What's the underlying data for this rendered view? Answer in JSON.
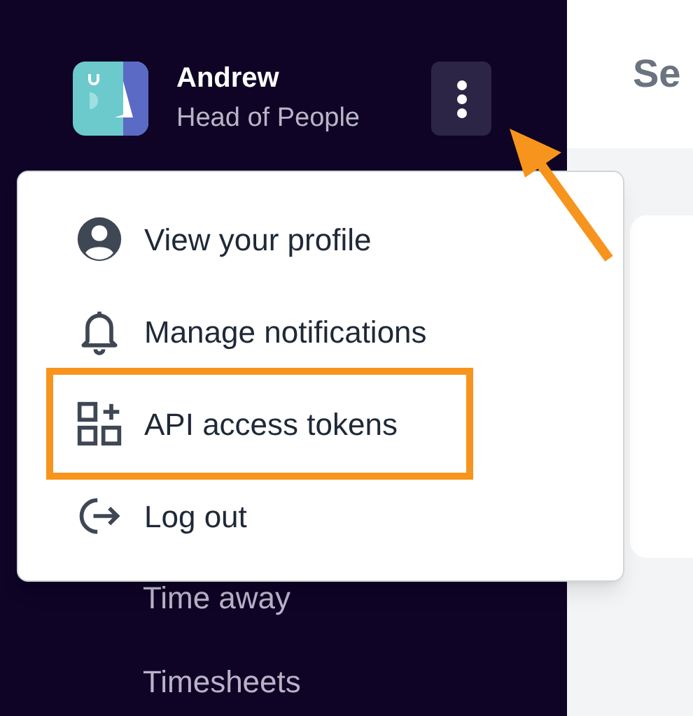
{
  "user": {
    "name": "Andrew",
    "role": "Head of People"
  },
  "page": {
    "title": "Se"
  },
  "menu": {
    "items": [
      {
        "label": "View your profile",
        "kind": "profile",
        "highlighted": false
      },
      {
        "label": "Manage notifications",
        "kind": "notifications",
        "highlighted": false
      },
      {
        "label": "API access tokens",
        "kind": "tokens",
        "highlighted": true
      },
      {
        "label": "Log out",
        "kind": "logout",
        "highlighted": false
      }
    ]
  },
  "sidebar": {
    "items": [
      {
        "label": "Time away"
      },
      {
        "label": "Timesheets"
      }
    ]
  }
}
